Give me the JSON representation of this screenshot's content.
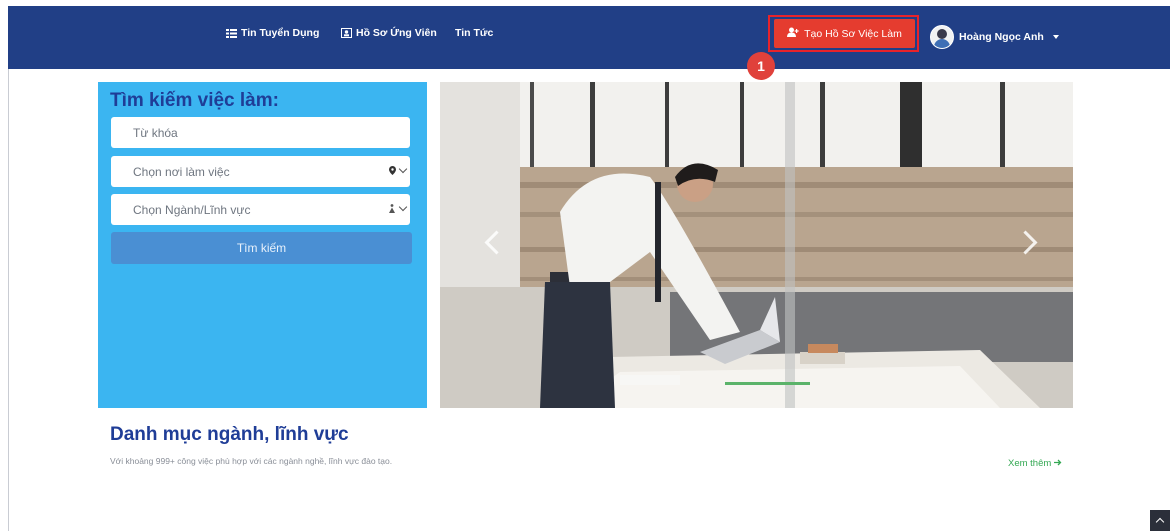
{
  "nav": {
    "jobs_label": "Tin Tuyển Dụng",
    "candidates_label": "Hồ Sơ Ứng Viên",
    "news_label": "Tin Tức",
    "create_button_label": "Tạo Hồ Sơ Việc Làm",
    "user_name": "Hoàng Ngọc Anh"
  },
  "annotation": {
    "step_number": "1",
    "highlight_color": "#e8232a"
  },
  "search": {
    "title": "Tìm kiếm việc làm:",
    "keyword_placeholder": "Từ khóa",
    "location_select": "Chọn nơi làm việc",
    "industry_select": "Chọn Ngành/Lĩnh vực",
    "submit_label": "Tìm kiếm"
  },
  "categories": {
    "title": "Danh mục ngành, lĩnh vực",
    "subtitle": "Với khoảng 999+ công việc phù hợp với các ngành nghề, lĩnh vực đào tạo.",
    "see_more_label": "Xem thêm"
  },
  "colors": {
    "header_bg": "#213f86",
    "accent_red": "#e53c2f",
    "panel_blue": "#3bb5f1",
    "title_blue": "#1f3d97",
    "link_green": "#34a853"
  }
}
